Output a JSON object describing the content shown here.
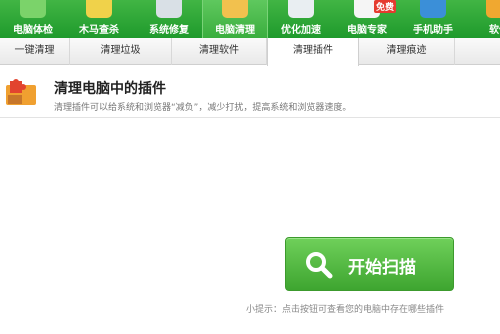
{
  "nav": {
    "items": [
      {
        "label": "电脑体检",
        "icon": "checkup-icon",
        "color": "#7bd36a"
      },
      {
        "label": "木马查杀",
        "icon": "trojan-icon",
        "color": "#f0d24a"
      },
      {
        "label": "系统修复",
        "icon": "repair-icon",
        "color": "#d9e0e6"
      },
      {
        "label": "电脑清理",
        "icon": "broom-icon",
        "color": "#f2c14e",
        "active": true
      },
      {
        "label": "优化加速",
        "icon": "rocket-icon",
        "color": "#e9eef2"
      },
      {
        "label": "电脑专家",
        "icon": "expert-icon",
        "color": "#f5f5f5",
        "badge": "免费"
      },
      {
        "label": "手机助手",
        "icon": "phone-icon",
        "color": "#3b8fd8"
      },
      {
        "label": "软件",
        "icon": "software-icon",
        "color": "#f0a830"
      }
    ]
  },
  "tabs": [
    "一键清理",
    "清理垃圾",
    "清理软件",
    "清理插件",
    "清理痕迹"
  ],
  "active_tab": "清理插件",
  "header": {
    "title": "清理电脑中的插件",
    "description": "清理插件可以给系统和浏览器“减负”，减少打扰，提高系统和浏览器速度。"
  },
  "scan_button": {
    "label": "开始扫描"
  },
  "tip": "小提示：点击按钮可查看您的电脑中存在哪些插件",
  "colors": {
    "nav_green": "#2aa636",
    "button_green": "#4cb83b",
    "puzzle_red": "#e2442f",
    "puzzle_orange": "#f0a030"
  }
}
